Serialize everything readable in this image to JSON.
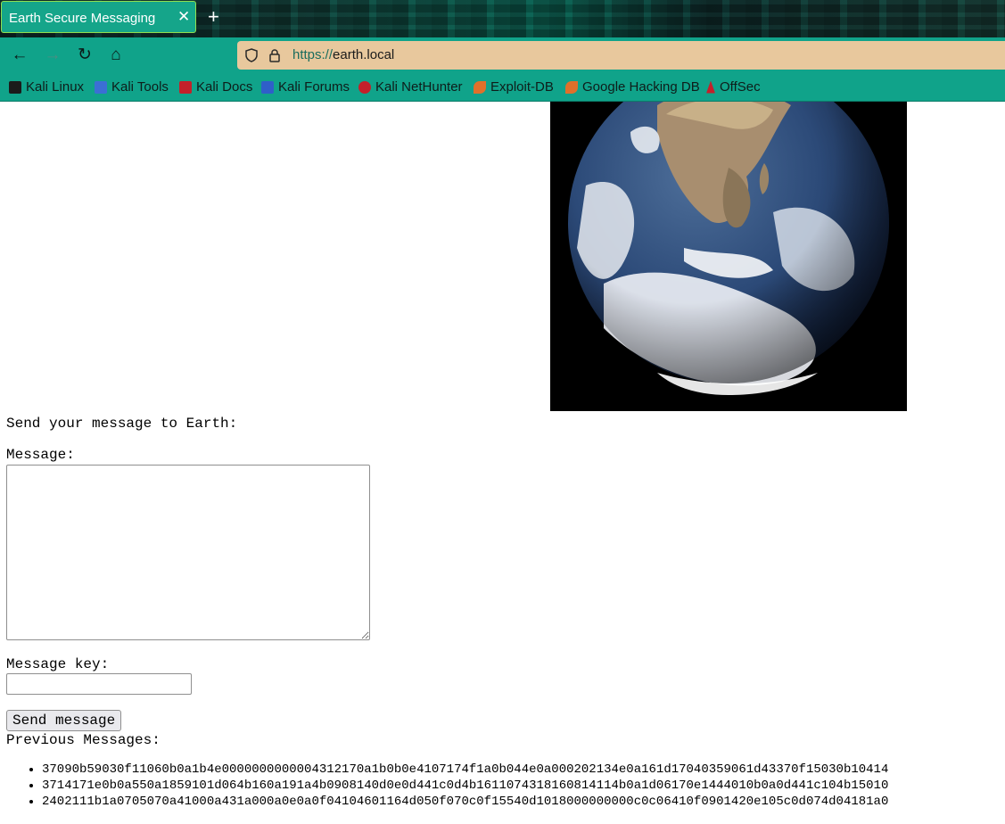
{
  "browser": {
    "tab_title": "Earth Secure Messaging",
    "tab_close": "✕",
    "new_tab": "+",
    "url_protocol": "https://",
    "url_host": "earth.local",
    "nav": {
      "back_icon": "←",
      "forward_icon": "→",
      "reload_icon": "↻",
      "home_icon": "⌂"
    },
    "bookmarks": [
      {
        "label": "Kali Linux",
        "color": "#1b1b1b"
      },
      {
        "label": "Kali Tools",
        "color": "#3b6fd4"
      },
      {
        "label": "Kali Docs",
        "color": "#c4202a"
      },
      {
        "label": "Kali Forums",
        "color": "#2f5fc9"
      },
      {
        "label": "Kali NetHunter",
        "color": "#c4202a"
      },
      {
        "label": "Exploit-DB",
        "color": "#e0702a"
      },
      {
        "label": "Google Hacking DB",
        "color": "#e0702a"
      },
      {
        "label": "OffSec",
        "color": "#c4202a"
      }
    ]
  },
  "page": {
    "prompt": "Send your message to Earth:",
    "message_label": "Message:",
    "message_value": "",
    "key_label": "Message key:",
    "key_value": "",
    "send_label": "Send message",
    "previous_label": "Previous Messages:",
    "messages": [
      "37090b59030f11060b0a1b4e0000000000004312170a1b0b0e4107174f1a0b044e0a000202134e0a161d17040359061d43370f15030b10414",
      "3714171e0b0a550a1859101d064b160a191a4b0908140d0e0d441c0d4b1611074318160814114b0a1d06170e1444010b0a0d441c104b15010",
      "2402111b1a0705070a41000a431a000a0e0a0f04104601164d050f070c0f15540d1018000000000c0c06410f0901420e105c0d074d04181a0"
    ]
  }
}
